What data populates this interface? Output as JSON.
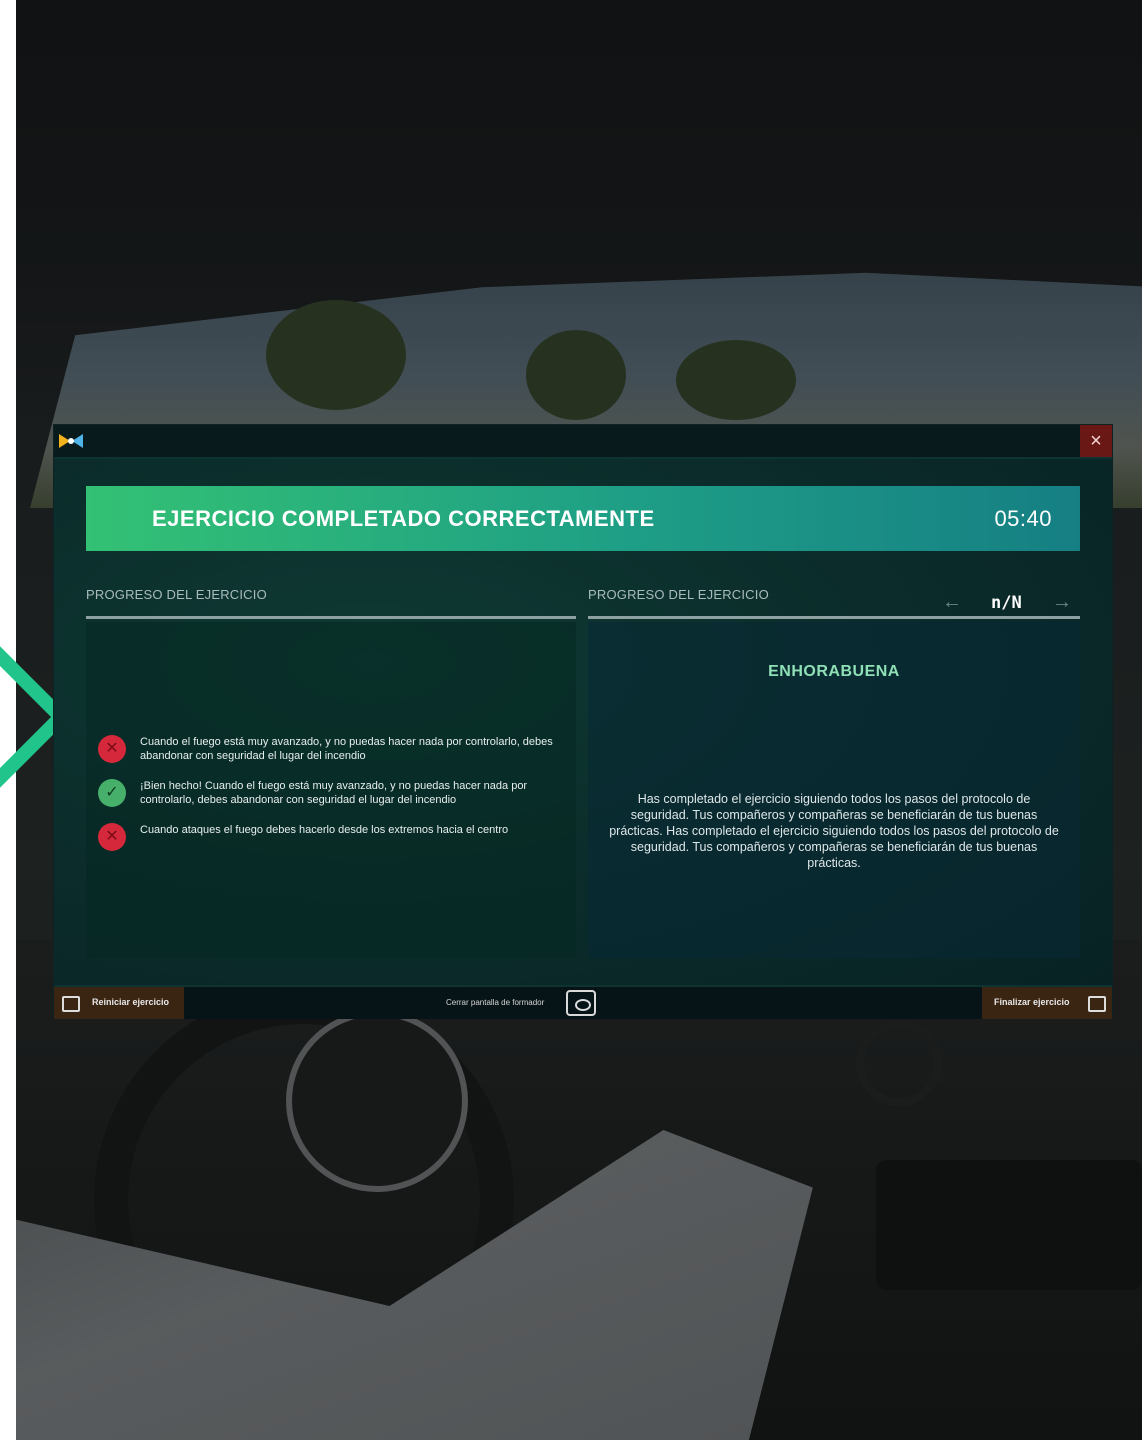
{
  "window": {
    "close_label": "×"
  },
  "banner": {
    "title": "EJERCICIO COMPLETADO CORRECTAMENTE",
    "timer": "05:40"
  },
  "left_column": {
    "title": "PROGRESO DEL EJERCICIO",
    "items": [
      {
        "status": "incorrect",
        "text": "Cuando el fuego está muy avanzado, y no puedas hacer nada por controlarlo, debes abandonar con seguridad el lugar del incendio"
      },
      {
        "status": "correct",
        "text": "¡Bien hecho! Cuando el fuego está muy avanzado, y no puedas hacer nada por controlarlo, debes abandonar con seguridad el lugar del incendio"
      },
      {
        "status": "incorrect",
        "text": "Cuando ataques el fuego debes hacerlo desde los extremos hacia el centro"
      }
    ]
  },
  "right_column": {
    "title": "PROGRESO DEL EJERCICIO",
    "pager": "n/N",
    "prev_arrow": "←",
    "next_arrow": "→",
    "heading": "ENHORABUENA",
    "body": "Has completado el ejercicio siguiendo todos los pasos del protocolo de seguridad. Tus compañeros y compañeras se beneficiarán de tus buenas prácticas. Has completado el ejercicio siguiendo todos los pasos del protocolo de seguridad. Tus compañeros y compañeras se beneficiarán de tus buenas prácticas."
  },
  "footer": {
    "restart_label": "Reiniciar ejercicio",
    "center_label": "Cerrar pantalla de formador",
    "finish_label": "Finalizar ejercicio"
  },
  "icons": {
    "logo": "app-logo-icon",
    "close": "close-icon",
    "incorrect": "cross-icon",
    "correct": "check-icon",
    "restart": "restart-icon",
    "trainer": "trainer-icon",
    "finish": "exit-icon"
  },
  "colors": {
    "banner_start": "#33c174",
    "banner_end": "#167f84",
    "incorrect": "#d6283b",
    "correct": "#46b06b",
    "heading": "#8fe0b6",
    "accent_chevron": "#21c48a"
  }
}
